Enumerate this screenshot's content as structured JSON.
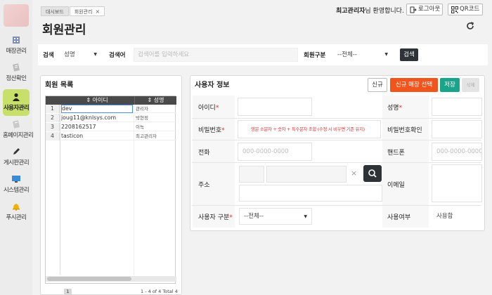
{
  "sidebar": {
    "items": [
      {
        "label": "매장관리",
        "icon": "store-icon"
      },
      {
        "label": "정산확인",
        "icon": "document-icon"
      },
      {
        "label": "사용자관리",
        "icon": "user-icon"
      },
      {
        "label": "홈페이지관리",
        "icon": "home-page-icon"
      },
      {
        "label": "게시판관리",
        "icon": "pencil-icon"
      },
      {
        "label": "시스템관리",
        "icon": "monitor-icon"
      },
      {
        "label": "푸시관리",
        "icon": "bell-icon"
      }
    ]
  },
  "tabs": [
    {
      "label": "대시보드"
    },
    {
      "label": "회원관리",
      "close": "×"
    }
  ],
  "header": {
    "welcome_name": "최고관리자",
    "welcome_suffix": "님 환영합니다.",
    "logout_label": "로그아웃",
    "qr_label": "QR코드",
    "page_title": "회원관리"
  },
  "search": {
    "search_label": "검색",
    "search_type_value": "성명",
    "keyword_label": "검색어",
    "keyword_placeholder": "검색어를 입력하세요",
    "member_type_label": "회원구분",
    "member_type_value": "--전체--",
    "search_button": "검색"
  },
  "member_list": {
    "title": "회원 목록",
    "columns": [
      "아이디",
      "성명"
    ],
    "rows": [
      {
        "num": "1",
        "id": "dev",
        "name": "관리자"
      },
      {
        "num": "2",
        "id": "joug11@knlsys.com",
        "name": "박현정"
      },
      {
        "num": "3",
        "id": "2208162517",
        "name": "이녹"
      },
      {
        "num": "4",
        "id": "tasticon",
        "name": "최고관리자"
      }
    ],
    "page": "1",
    "pager_info": "1 - 4 of 4   Total 4"
  },
  "user_info": {
    "title": "사용자 정보",
    "buttons": {
      "new": "신규",
      "new_store": "신규 매장 선택",
      "save": "저장",
      "delete": "삭제"
    },
    "fields": {
      "id_label": "아이디",
      "name_label": "성명",
      "password_label": "비밀번호",
      "password_hint": "영문 소문자 + 숫자 + 특수문자 조합 (수정 시 비우면 기존 유지)",
      "password_confirm_label": "비밀번호확인",
      "phone_label": "전화",
      "phone_placeholder": "000-0000-0000",
      "mobile_label": "핸드폰",
      "mobile_placeholder": "000-0000-0000",
      "address_label": "주소",
      "email_label": "이메일",
      "user_type_label": "사용자 구분",
      "user_type_value": "--전체--",
      "use_label": "사용여부",
      "use_value": "사용함",
      "required_mark": "*",
      "clear_symbol": "×"
    }
  },
  "colors": {
    "sidebar_active": "#c8e06a",
    "new_store_button": "#f0551e",
    "save_button": "#1aa58a",
    "search_button": "#2e3338",
    "required": "#e03030"
  }
}
